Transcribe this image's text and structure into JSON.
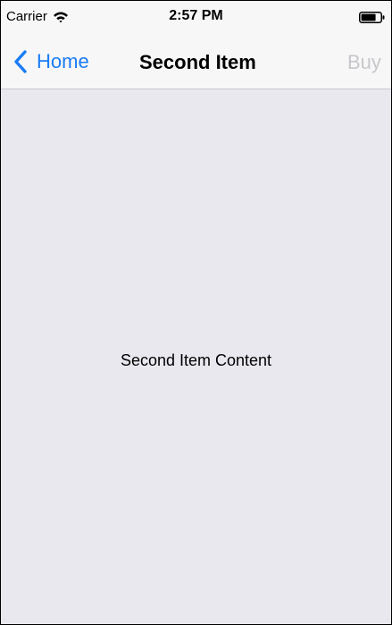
{
  "status_bar": {
    "carrier": "Carrier",
    "wifi_icon": "wifi-icon",
    "time": "2:57 PM",
    "battery_icon": "battery-icon"
  },
  "nav_bar": {
    "back_label": "Home",
    "back_icon": "chevron-left-icon",
    "title": "Second Item",
    "right_button_label": "Buy"
  },
  "content": {
    "label": "Second Item Content"
  },
  "colors": {
    "accent": "#1a7cf6",
    "disabled_button": "#c7c7cc",
    "content_background": "#e9e8ef",
    "bar_background": "#f7f7f7"
  }
}
